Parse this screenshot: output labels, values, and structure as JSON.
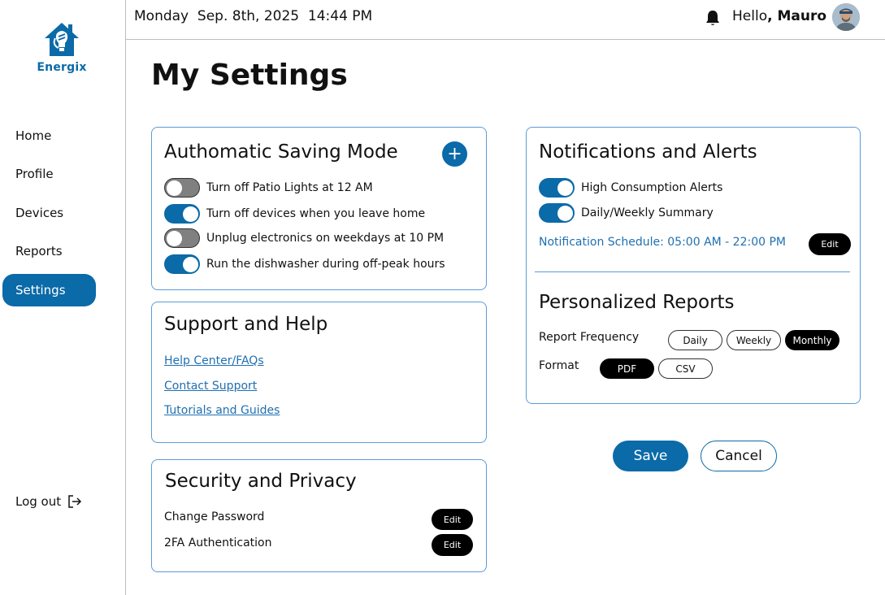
{
  "app": {
    "name": "Energix",
    "brand_color": "#0b6aa8"
  },
  "header": {
    "datetime": "Monday  Sep. 8th, 2025  14:44 PM",
    "greeting_prefix": "Hello",
    "greeting_sep": ", ",
    "user_name": "Mauro",
    "bell_icon": "bell-icon"
  },
  "sidebar": {
    "items": [
      {
        "label": "Home",
        "active": false
      },
      {
        "label": "Profile",
        "active": false
      },
      {
        "label": "Devices",
        "active": false
      },
      {
        "label": "Reports",
        "active": false
      },
      {
        "label": "Settings",
        "active": true
      }
    ],
    "logout_label": "Log out",
    "logout_icon": "logout-icon"
  },
  "page_title": "My Settings",
  "saving_mode": {
    "title": "Authomatic Saving Mode",
    "add_icon": "plus-icon",
    "rules": [
      {
        "label": "Turn off Patio Lights at 12 AM",
        "enabled": false
      },
      {
        "label": "Turn off devices when you leave home",
        "enabled": true
      },
      {
        "label": "Unplug electronics on weekdays at 10 PM",
        "enabled": false
      },
      {
        "label": "Run the dishwasher during off-peak hours",
        "enabled": true
      }
    ]
  },
  "support": {
    "title": "Support and Help",
    "links": [
      "Help Center/FAQs",
      "Contact Support",
      "Tutorials and Guides"
    ]
  },
  "security": {
    "title": "Security and Privacy",
    "rows": [
      {
        "label": "Change Password",
        "action": "Edit"
      },
      {
        "label": "2FA Authentication",
        "action": "Edit"
      }
    ]
  },
  "notifications": {
    "title": "Notifications and Alerts",
    "toggles": [
      {
        "label": "High Consumption Alerts",
        "enabled": true
      },
      {
        "label": "Daily/Weekly Summary",
        "enabled": true
      }
    ],
    "schedule": "Notification Schedule: 05:00 AM - 22:00 PM",
    "schedule_action": "Edit"
  },
  "reports": {
    "title": "Personalized Reports",
    "frequency_label": "Report Frequency",
    "frequency_options": [
      "Daily",
      "Weekly",
      "Monthly"
    ],
    "frequency_selected": "Monthly",
    "format_label": "Format",
    "format_options": [
      "PDF",
      "CSV"
    ],
    "format_selected": "PDF"
  },
  "actions": {
    "save": "Save",
    "cancel": "Cancel"
  }
}
